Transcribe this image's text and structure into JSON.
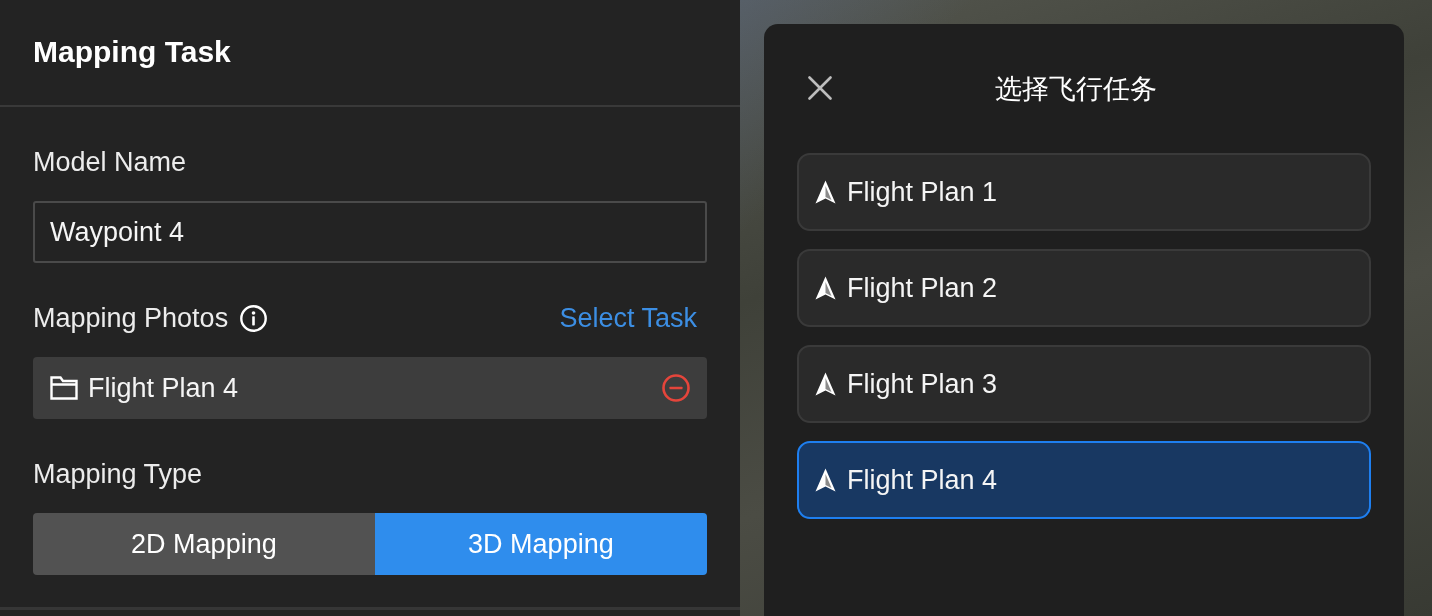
{
  "panel": {
    "title": "Mapping Task"
  },
  "model_name": {
    "label": "Model Name",
    "value": "Waypoint 4"
  },
  "mapping_photos": {
    "label": "Mapping Photos",
    "action": "Select Task",
    "selected_task": "Flight Plan 4"
  },
  "mapping_type": {
    "label": "Mapping Type",
    "options": [
      {
        "label": "2D Mapping",
        "selected": false
      },
      {
        "label": "3D Mapping",
        "selected": true
      }
    ]
  },
  "dialog": {
    "title": "选择飞行任务",
    "items": [
      {
        "label": "Flight Plan 1",
        "selected": false
      },
      {
        "label": "Flight Plan 2",
        "selected": false
      },
      {
        "label": "Flight Plan 3",
        "selected": false
      },
      {
        "label": "Flight Plan 4",
        "selected": true
      }
    ]
  }
}
